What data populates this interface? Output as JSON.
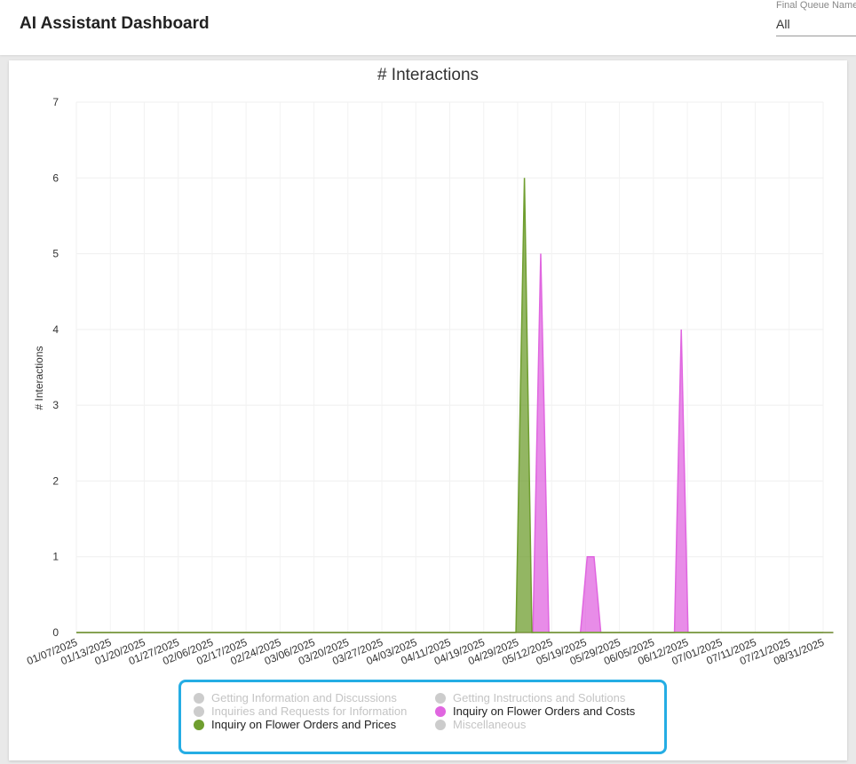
{
  "header": {
    "title": "AI Assistant Dashboard",
    "filter_label": "Final Queue Name",
    "filter_value": "All"
  },
  "chart_data": {
    "type": "area",
    "title": "# Interactions",
    "ylabel": "# Interactions",
    "xlabel": "",
    "ylim": [
      0,
      7
    ],
    "yticks": [
      0,
      1,
      2,
      3,
      4,
      5,
      6,
      7
    ],
    "categories": [
      "01/07/2025",
      "01/13/2025",
      "01/20/2025",
      "01/27/2025",
      "02/06/2025",
      "02/17/2025",
      "02/24/2025",
      "03/06/2025",
      "03/20/2025",
      "03/27/2025",
      "04/03/2025",
      "04/11/2025",
      "04/19/2025",
      "04/29/2025",
      "05/12/2025",
      "05/19/2025",
      "05/29/2025",
      "06/05/2025",
      "06/12/2025",
      "07/01/2025",
      "07/11/2025",
      "07/21/2025",
      "08/31/2025"
    ],
    "grid": true,
    "legend_position": "bottom",
    "series": [
      {
        "name": "Getting Information and Discussions",
        "color": "#cccccc",
        "hidden": true,
        "points": []
      },
      {
        "name": "Getting Instructions and Solutions",
        "color": "#cccccc",
        "hidden": true,
        "points": []
      },
      {
        "name": "Inquiries and Requests for Information",
        "color": "#cccccc",
        "hidden": true,
        "points": []
      },
      {
        "name": "Inquiry on Flower Orders and Costs",
        "color": "#e066e0",
        "hidden": false,
        "points": [
          [
            0,
            0
          ],
          [
            13.2,
            0
          ],
          [
            13.45,
            0
          ],
          [
            13.68,
            5
          ],
          [
            13.92,
            0
          ],
          [
            14.85,
            0
          ],
          [
            15.05,
            1
          ],
          [
            15.25,
            1
          ],
          [
            15.45,
            0
          ],
          [
            17.62,
            0
          ],
          [
            17.82,
            4
          ],
          [
            18.02,
            0
          ],
          [
            22.3,
            0
          ]
        ]
      },
      {
        "name": "Inquiry on Flower Orders and Prices",
        "color": "#6f9e2f",
        "hidden": false,
        "points": [
          [
            0,
            0
          ],
          [
            12.95,
            0
          ],
          [
            13.2,
            6
          ],
          [
            13.42,
            0
          ],
          [
            22.3,
            0
          ]
        ]
      },
      {
        "name": "Miscellaneous",
        "color": "#cccccc",
        "hidden": true,
        "points": []
      }
    ]
  }
}
